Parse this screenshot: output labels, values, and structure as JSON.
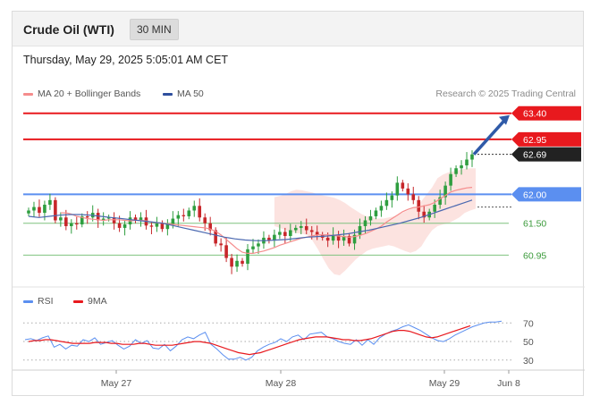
{
  "header": {
    "instrument": "Crude Oil (WTI)",
    "interval": "30 MIN"
  },
  "datetime": "Thursday, May 29, 2025 5:05:01 AM CET",
  "legend": {
    "ma20": "MA 20 + Bollinger Bands",
    "ma50": "MA 50"
  },
  "credit": "Research © 2025 Trading Central",
  "rsi_legend": {
    "rsi": "RSI",
    "ma": "9MA"
  },
  "colors": {
    "resistance": "#e8191e",
    "support": "#5b8ff0",
    "support_green": "#3a9a3a",
    "price_tag": "#222222",
    "arrow": "#2f5aa8",
    "candle_up": "#2e9e3f",
    "candle_down": "#c7262a",
    "bollinger_fill": "#fbd9d6",
    "ma20": "#f58c8c",
    "ma50": "#4a68b0",
    "rsi": "#5b8ff0",
    "rsi_ma": "#e8191e"
  },
  "chart_data": [
    {
      "type": "candlestick",
      "title": "Crude Oil (WTI)",
      "ylim": [
        60.6,
        63.55
      ],
      "x_labels": [
        "May 27",
        "May 28",
        "May 29",
        "Jun 8"
      ],
      "levels": [
        {
          "label": "63.40",
          "value": 63.4,
          "kind": "resistance"
        },
        {
          "label": "62.95",
          "value": 62.95,
          "kind": "resistance"
        },
        {
          "label": "62.69",
          "value": 62.69,
          "kind": "last_price"
        },
        {
          "label": "62.00",
          "value": 62.0,
          "kind": "pivot"
        },
        {
          "label": "61.50",
          "value": 61.5,
          "kind": "support"
        },
        {
          "label": "60.95",
          "value": 60.95,
          "kind": "support"
        }
      ],
      "closes": [
        61.72,
        61.78,
        61.68,
        61.82,
        61.9,
        61.55,
        61.6,
        61.45,
        61.5,
        61.48,
        61.62,
        61.6,
        61.68,
        61.55,
        61.58,
        61.6,
        61.5,
        61.42,
        61.48,
        61.6,
        61.55,
        61.6,
        61.46,
        61.44,
        61.5,
        61.4,
        61.48,
        61.58,
        61.64,
        61.62,
        61.72,
        61.8,
        61.6,
        61.5,
        61.38,
        61.15,
        61.12,
        60.9,
        60.75,
        60.85,
        60.8,
        61.05,
        61.1,
        61.15,
        61.25,
        61.2,
        61.3,
        61.35,
        61.28,
        61.38,
        61.42,
        61.45,
        61.38,
        61.35,
        61.3,
        61.25,
        61.2,
        61.3,
        61.2,
        61.28,
        61.15,
        61.3,
        61.45,
        61.55,
        61.62,
        61.72,
        61.8,
        61.9,
        61.98,
        62.2,
        62.1,
        62.0,
        61.9,
        61.7,
        61.6,
        61.7,
        61.82,
        61.95,
        62.15,
        62.35,
        62.45,
        62.5,
        62.6,
        62.69
      ],
      "ma20": [
        61.68,
        61.68,
        61.66,
        61.62,
        61.6,
        61.58,
        61.57,
        61.56,
        61.55,
        61.56,
        61.56,
        61.56,
        61.55,
        61.54,
        61.55,
        61.55,
        61.54,
        61.52,
        61.51,
        61.5,
        61.49,
        61.48,
        61.47,
        61.46,
        61.45,
        61.44,
        61.43,
        61.42,
        61.4,
        61.36,
        61.3,
        61.22,
        61.14,
        61.06,
        61.0,
        60.98,
        60.98,
        61.0,
        61.02,
        61.05,
        61.08,
        61.12,
        61.15,
        61.18,
        61.21,
        61.24,
        61.26,
        61.28,
        61.3,
        61.3,
        61.3,
        61.29,
        61.28,
        61.27,
        61.26,
        61.27,
        61.29,
        61.32,
        61.36,
        61.4,
        61.45,
        61.52,
        61.58,
        61.64,
        61.7,
        61.74,
        61.77,
        61.78,
        61.8,
        61.82,
        61.86,
        61.92,
        61.98,
        62.04,
        62.07,
        62.09,
        62.11,
        62.12
      ],
      "ma50": [
        61.62,
        61.6,
        61.62,
        61.64,
        61.65,
        61.65,
        61.64,
        61.62,
        61.6,
        61.58,
        61.56,
        61.54,
        61.52,
        61.5,
        61.46,
        61.42,
        61.38,
        61.34,
        61.3,
        61.26,
        61.23,
        61.21,
        61.2,
        61.2,
        61.21,
        61.22,
        61.24,
        61.26,
        61.27,
        61.28,
        61.3,
        61.32,
        61.35,
        61.38,
        61.42,
        61.46,
        61.5,
        61.55,
        61.6,
        61.66,
        61.72,
        61.78,
        61.84,
        61.9
      ],
      "bb_upper": [
        61.95,
        61.97,
        62.0,
        62.05,
        62.08,
        62.07,
        62.05,
        62.03,
        62.0,
        61.98,
        61.96,
        61.94,
        61.9,
        61.85,
        61.78,
        61.72,
        61.66,
        61.62,
        61.6,
        61.58,
        61.58,
        61.6,
        61.62,
        61.66,
        61.7,
        61.74,
        61.78,
        61.88,
        62.0,
        62.12,
        62.28,
        62.34,
        62.38,
        62.4,
        62.42,
        62.44,
        62.45,
        62.45
      ],
      "bb_lower": [
        61.45,
        61.42,
        61.38,
        61.35,
        61.33,
        61.32,
        61.3,
        61.2,
        61.05,
        60.88,
        60.72,
        60.62,
        60.6,
        60.68,
        60.78,
        60.88,
        60.95,
        61.02,
        61.06,
        61.08,
        61.1,
        61.12,
        61.1,
        61.06,
        61.02,
        60.99,
        61.02,
        61.1,
        61.25,
        61.38,
        61.45,
        61.48,
        61.5,
        61.55,
        61.6,
        61.68,
        61.72,
        61.75
      ]
    },
    {
      "type": "line",
      "title": "RSI",
      "ylim": [
        25,
        78
      ],
      "y_ticks": [
        70,
        50,
        30
      ],
      "series": [
        {
          "name": "RSI",
          "values": [
            52,
            53,
            51,
            54,
            56,
            44,
            47,
            42,
            46,
            45,
            52,
            50,
            54,
            47,
            49,
            51,
            46,
            42,
            45,
            52,
            48,
            51,
            43,
            42,
            47,
            40,
            45,
            52,
            55,
            53,
            57,
            60,
            47,
            42,
            36,
            31,
            31,
            33,
            30,
            33,
            40,
            44,
            47,
            49,
            53,
            50,
            55,
            57,
            52,
            58,
            59,
            60,
            55,
            53,
            50,
            48,
            47,
            52,
            46,
            52,
            47,
            54,
            58,
            61,
            63,
            66,
            68,
            65,
            62,
            58,
            54,
            51,
            50,
            53,
            57,
            60,
            63,
            66,
            68,
            70,
            71,
            71,
            72
          ]
        },
        {
          "name": "9MA",
          "values": [
            50,
            51,
            51,
            52,
            52,
            51,
            50,
            49,
            48,
            48,
            48,
            48,
            49,
            49,
            49,
            48,
            48,
            47,
            47,
            47,
            48,
            48,
            47,
            46,
            46,
            46,
            46,
            47,
            48,
            49,
            50,
            50,
            49,
            48,
            46,
            44,
            42,
            40,
            38,
            37,
            36,
            37,
            38,
            40,
            42,
            44,
            46,
            48,
            50,
            52,
            53,
            54,
            55,
            55,
            55,
            54,
            53,
            52,
            52,
            51,
            51,
            52,
            53,
            55,
            57,
            59,
            61,
            62,
            62,
            61,
            59,
            57,
            55,
            54,
            55,
            57,
            59,
            61,
            63,
            65,
            67
          ]
        }
      ]
    }
  ]
}
